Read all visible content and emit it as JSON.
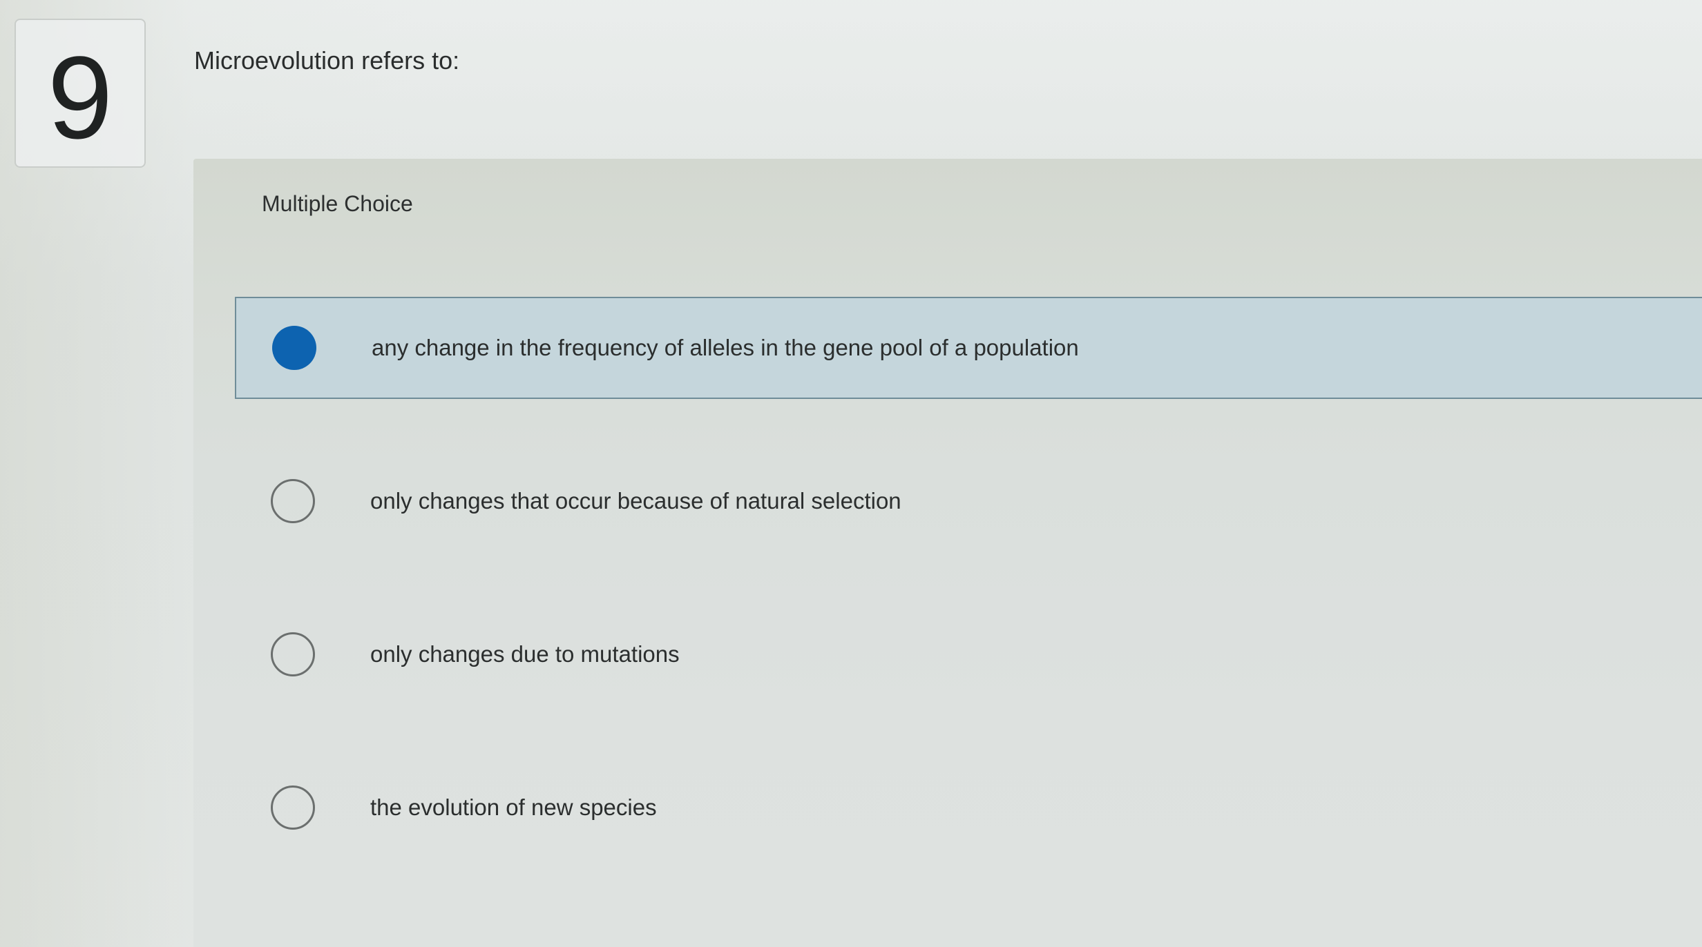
{
  "question": {
    "number": "9",
    "text": "Microevolution refers to:",
    "type_label": "Multiple Choice"
  },
  "options": [
    {
      "label": "any change in the frequency of alleles in the gene pool of a population",
      "selected": true
    },
    {
      "label": "only changes that occur because of natural selection",
      "selected": false
    },
    {
      "label": "only changes due to mutations",
      "selected": false
    },
    {
      "label": "the evolution of new species",
      "selected": false
    }
  ],
  "colors": {
    "selected_radio": "#0d63b0",
    "selected_row_background": "#c5d6dc",
    "selected_row_border": "#6f8d99"
  }
}
